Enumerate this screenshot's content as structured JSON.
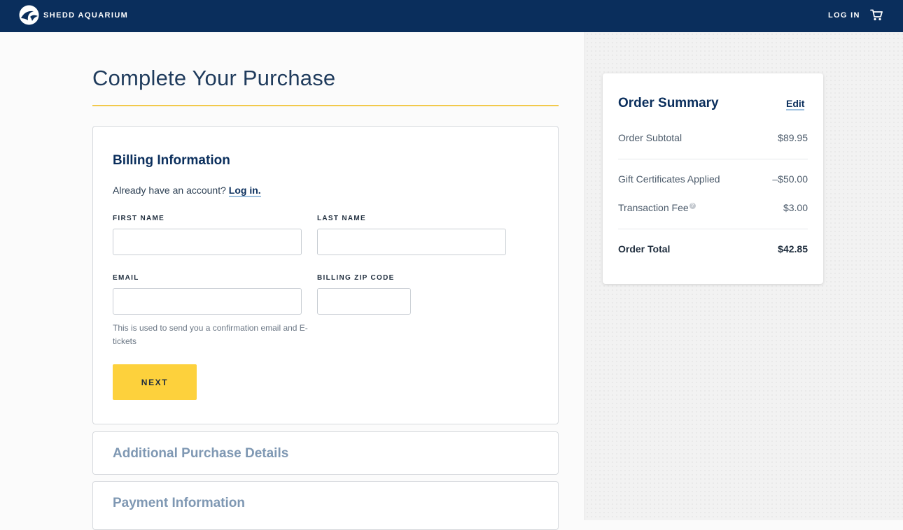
{
  "header": {
    "brand_name": "SHEDD AQUARIUM",
    "login_label": "LOG IN",
    "icons": [
      "shedd-logo-icon",
      "cart-icon"
    ],
    "bg_color": "#0a2e5c"
  },
  "page": {
    "title": "Complete Your Purchase",
    "accent_color": "#f2c94c"
  },
  "billing": {
    "title": "Billing Information",
    "account_prompt": "Already have an account?",
    "account_link": "Log in.",
    "first_name_label": "FIRST NAME",
    "first_name_value": "",
    "last_name_label": "LAST NAME",
    "last_name_value": "",
    "email_label": "EMAIL",
    "email_value": "",
    "zip_label": "BILLING ZIP CODE",
    "zip_value": "",
    "email_hint": "This is used to send you a confirmation email and E-tickets",
    "next_label": "NEXT",
    "button_color": "#fdd13c"
  },
  "sections": {
    "additional_title": "Additional Purchase Details",
    "payment_title": "Payment Information"
  },
  "summary": {
    "title": "Order Summary",
    "edit_label": "Edit",
    "subtotal_label": "Order Subtotal",
    "subtotal_value": "$89.95",
    "gift_label": "Gift Certificates Applied",
    "gift_value": "–$50.00",
    "fee_label": "Transaction Fee",
    "fee_info": "?",
    "fee_value": "$3.00",
    "total_label": "Order Total",
    "total_value": "$42.85"
  }
}
